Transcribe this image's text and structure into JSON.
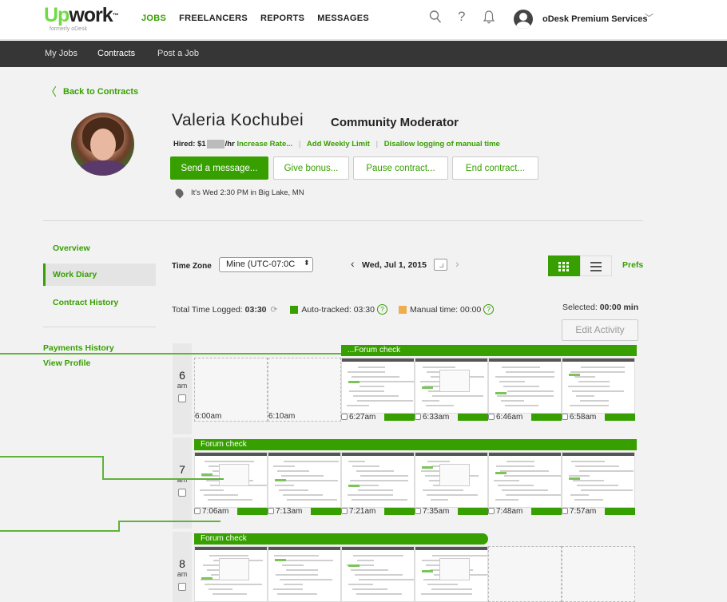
{
  "header": {
    "logo_up": "Up",
    "logo_work": "work",
    "logo_tm": "™",
    "logo_sub": "formerly oDesk",
    "nav": [
      "JOBS",
      "FREELANCERS",
      "REPORTS",
      "MESSAGES"
    ],
    "account": "oDesk Premium Services",
    "icons": [
      "search-icon",
      "help-icon",
      "bell-icon",
      "avatar-icon",
      "chevron-down-icon"
    ]
  },
  "subnav": {
    "items": [
      "My Jobs",
      "Contracts",
      "Post a Job"
    ]
  },
  "contract": {
    "back_label": "Back to Contracts",
    "name": "Valeria Kochubei",
    "role": "Community Moderator",
    "hired_label": "Hired:",
    "rate_prefix": "$1",
    "rate_suffix": "/hr",
    "links": [
      "Increase Rate...",
      "Add Weekly Limit",
      "Disallow logging of manual time"
    ],
    "buttons": [
      "Send a message...",
      "Give bonus...",
      "Pause contract...",
      "End contract..."
    ],
    "location": "It's Wed 2:30 PM in Big Lake, MN"
  },
  "sidebar": {
    "items": [
      "Overview",
      "Work Diary",
      "Contract History",
      "Payments History",
      "View Profile"
    ],
    "selected": "Work Diary"
  },
  "diary": {
    "timezone_label": "Time Zone",
    "timezone_value": "Mine (UTC-07:0C",
    "date": "Wed, Jul 1, 2015",
    "prefs": "Prefs",
    "total_label": "Total Time Logged:",
    "total_value": "03:30",
    "auto_label": "Auto-tracked: 03:30",
    "manual_label": "Manual time: 00:00",
    "selected_label": "Selected:",
    "selected_value": "00:00 min",
    "edit_activity": "Edit Activity",
    "colors": {
      "accent": "#37a000",
      "manual": "#f0ad4e",
      "subnav": "#363636"
    },
    "hours": [
      {
        "hour": "6",
        "ampm": "am",
        "segment": "...Forum check",
        "slots": [
          {
            "time": "6:00am",
            "filled": false
          },
          {
            "time": "6:10am",
            "filled": false
          },
          {
            "time": "6:27am",
            "filled": true
          },
          {
            "time": "6:33am",
            "filled": true
          },
          {
            "time": "6:46am",
            "filled": true
          },
          {
            "time": "6:58am",
            "filled": true
          }
        ]
      },
      {
        "hour": "7",
        "ampm": "am",
        "segment": "Forum check",
        "slots": [
          {
            "time": "7:06am",
            "filled": true
          },
          {
            "time": "7:13am",
            "filled": true
          },
          {
            "time": "7:21am",
            "filled": true
          },
          {
            "time": "7:35am",
            "filled": true
          },
          {
            "time": "7:48am",
            "filled": true
          },
          {
            "time": "7:57am",
            "filled": true
          }
        ]
      },
      {
        "hour": "8",
        "ampm": "am",
        "segment": "Forum check",
        "slots": [
          {
            "time": "",
            "filled": true
          },
          {
            "time": "",
            "filled": true
          },
          {
            "time": "",
            "filled": true
          },
          {
            "time": "",
            "filled": true
          },
          {
            "time": "",
            "filled": false
          },
          {
            "time": "",
            "filled": false
          }
        ]
      }
    ]
  }
}
